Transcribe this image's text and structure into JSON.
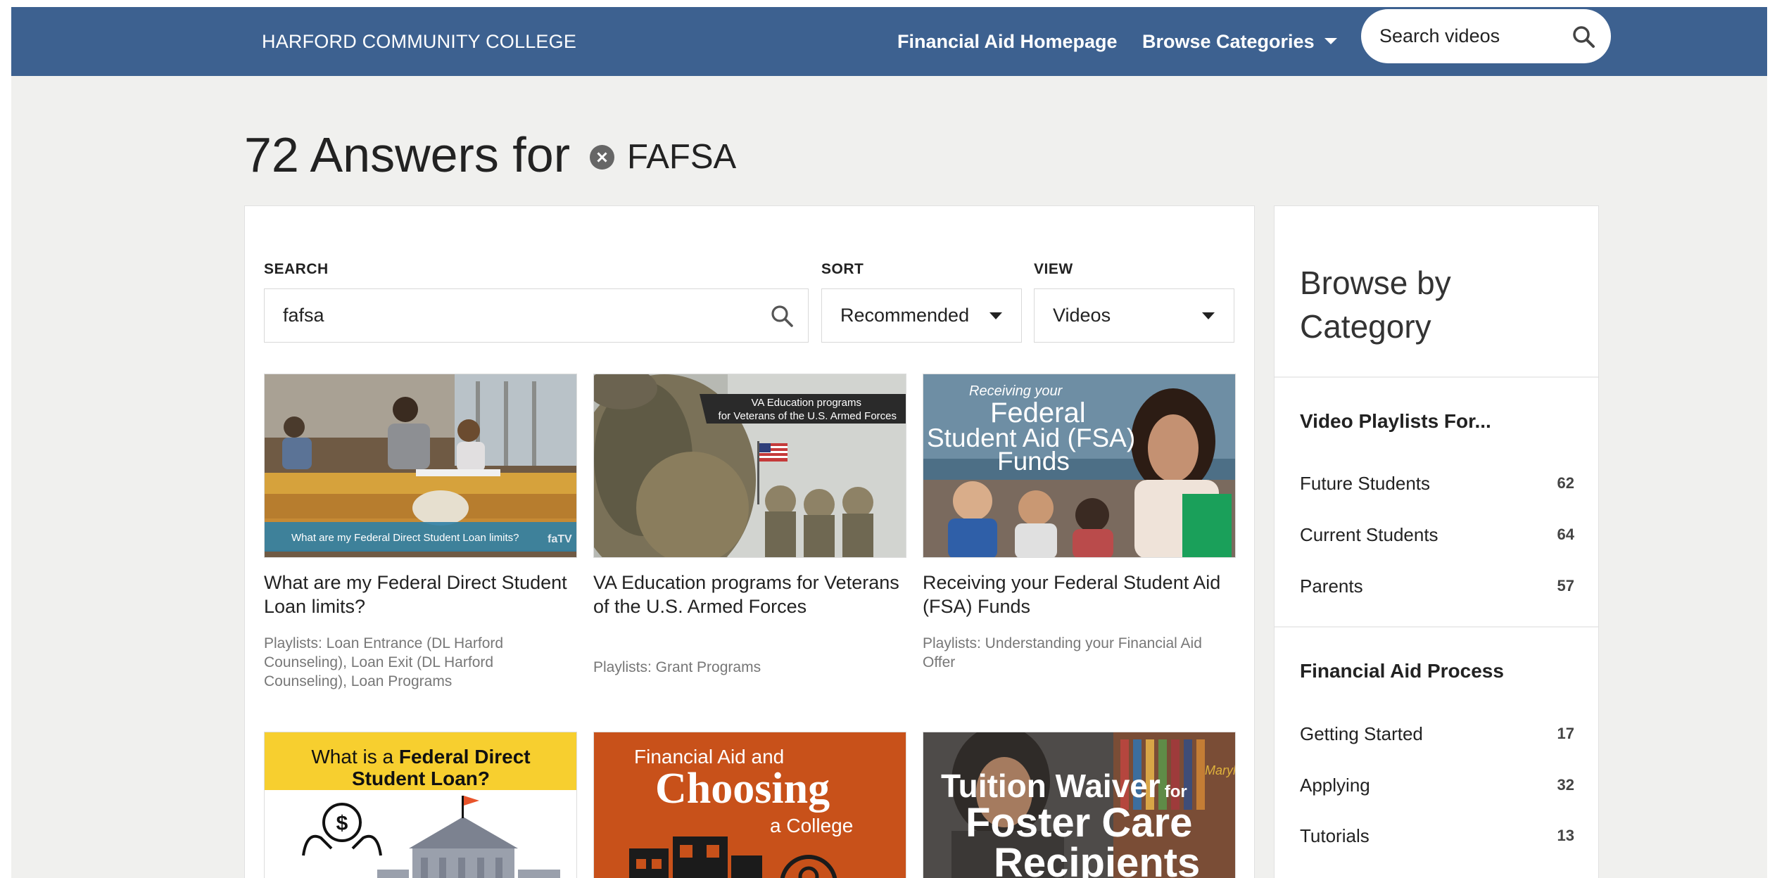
{
  "header": {
    "brand": "HARFORD COMMUNITY COLLEGE",
    "nav_financial_aid": "Financial Aid Homepage",
    "nav_browse": "Browse Categories",
    "search_placeholder": "Search videos"
  },
  "results": {
    "count_text": "72 Answers for",
    "filter_term": "FAFSA"
  },
  "controls": {
    "search_label": "SEARCH",
    "search_value": "fafsa",
    "sort_label": "SORT",
    "sort_value": "Recommended",
    "view_label": "VIEW",
    "view_value": "Videos"
  },
  "videos": [
    {
      "title": "What are my Federal Direct Student Loan limits?",
      "playlists": "Playlists: Loan Entrance (DL Harford Counseling), Loan Exit (DL Harford Counseling), Loan Programs",
      "thumb_caption": "What are my Federal Direct Student Loan limits?",
      "thumb_logo": "faTV"
    },
    {
      "title": "VA Education programs for Veterans of the U.S. Armed Forces",
      "playlists": "Playlists: Grant Programs",
      "thumb_banner_line1": "VA Education programs",
      "thumb_banner_line2": "for Veterans of the U.S. Armed Forces"
    },
    {
      "title": "Receiving your Federal Student Aid (FSA) Funds",
      "playlists": "Playlists: Understanding your Financial Aid Offer",
      "thumb_line1": "Receiving your",
      "thumb_line2": "Federal",
      "thumb_line3": "Student Aid (FSA)",
      "thumb_line4": "Funds"
    },
    {
      "thumb_line1_pre": "What is a ",
      "thumb_line1_bold": "Federal Direct",
      "thumb_line2": "Student Loan?"
    },
    {
      "thumb_line1": "Financial Aid and",
      "thumb_line2": "Choosing",
      "thumb_line3": "a College"
    },
    {
      "thumb_tag": "Maryland",
      "thumb_line1": "Tuition Waiver",
      "thumb_line1_small": "for",
      "thumb_line2": "Foster Care",
      "thumb_line3": "Recipients"
    }
  ],
  "sidebar": {
    "title": "Browse by Category",
    "sections": [
      {
        "heading": "Video Playlists For...",
        "items": [
          {
            "label": "Future Students",
            "count": "62"
          },
          {
            "label": "Current Students",
            "count": "64"
          },
          {
            "label": "Parents",
            "count": "57"
          }
        ]
      },
      {
        "heading": "Financial Aid Process",
        "items": [
          {
            "label": "Getting Started",
            "count": "17"
          },
          {
            "label": "Applying",
            "count": "32"
          },
          {
            "label": "Tutorials",
            "count": "13"
          }
        ]
      }
    ]
  },
  "colors": {
    "header_bg": "#3d6190",
    "page_bg": "#f0f0ee",
    "card_yellow": "#f7cf2f",
    "card_orange": "#c8511a"
  },
  "icons": [
    "search-icon",
    "chevron-down-icon",
    "close-circle-icon",
    "flag-icon",
    "dollar-icon"
  ]
}
